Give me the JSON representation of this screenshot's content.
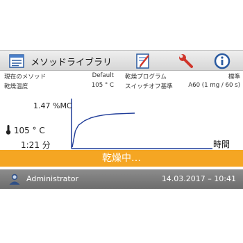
{
  "toolbar": {
    "title": "メソッドライブラリ",
    "icons": [
      "method-library-icon",
      "drying-program-icon",
      "wrench-icon",
      "info-icon"
    ]
  },
  "info": {
    "row1": {
      "label1": "現在のメソッド",
      "value1": "Default",
      "label2": "乾燥プログラム",
      "value2": "標準"
    },
    "row2": {
      "label1": "乾燥温度",
      "value1": "105 ° C",
      "label2": "スイッチオフ基準",
      "value2": "A60 (1 mg / 60 s)"
    }
  },
  "chart": {
    "mc_value": "1.47 %MC",
    "temperature": "105 ° C",
    "elapsed": "1:21 分",
    "x_axis_label": "時間"
  },
  "chart_data": {
    "type": "line",
    "title": "",
    "xlabel": "時間",
    "ylabel": "",
    "series": [
      {
        "x": [
          0,
          0.05,
          0.1,
          0.2,
          0.3,
          0.4,
          0.5,
          0.6,
          0.7,
          0.8,
          0.9,
          1.0
        ],
        "y": [
          0,
          0.7,
          0.95,
          1.15,
          1.27,
          1.34,
          1.39,
          1.42,
          1.44,
          1.45,
          1.46,
          1.47
        ]
      }
    ]
  },
  "status": {
    "text": "乾燥中…"
  },
  "footer": {
    "user": "Administrator",
    "datetime": "14.03.2017 – 10:41"
  },
  "colors": {
    "status_bg": "#f5a623",
    "footer_bg": "#7a7a7a",
    "curve": "#1f3c99"
  }
}
